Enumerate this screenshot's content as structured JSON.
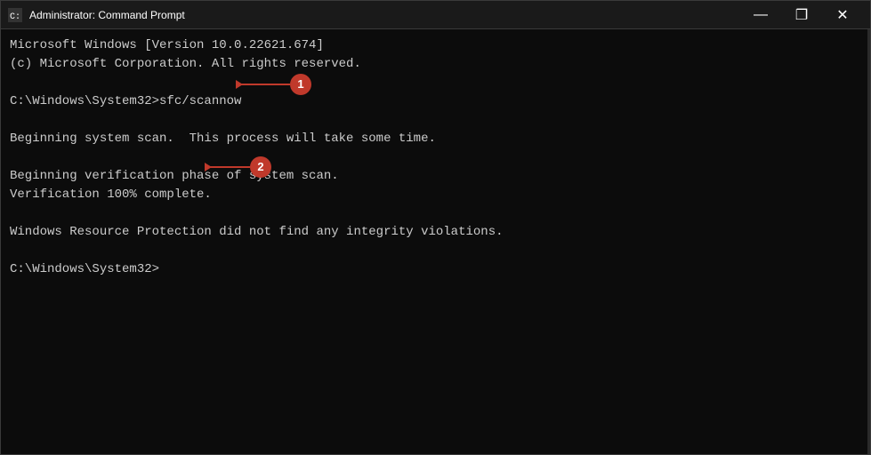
{
  "window": {
    "title": "Administrator: Command Prompt",
    "icon": "cmd-icon"
  },
  "titlebar": {
    "minimize_label": "—",
    "maximize_label": "❐",
    "close_label": "✕"
  },
  "terminal": {
    "lines": [
      "Microsoft Windows [Version 10.0.22621.674]",
      "(c) Microsoft Corporation. All rights reserved.",
      "",
      "C:\\Windows\\System32>sfc/scannow",
      "",
      "Beginning system scan.  This process will take some time.",
      "",
      "Beginning verification phase of system scan.",
      "Verification 100% complete.",
      "",
      "Windows Resource Protection did not find any integrity violations.",
      "",
      "C:\\Windows\\System32>"
    ]
  },
  "annotations": [
    {
      "id": "1",
      "label": "1"
    },
    {
      "id": "2",
      "label": "2"
    }
  ]
}
